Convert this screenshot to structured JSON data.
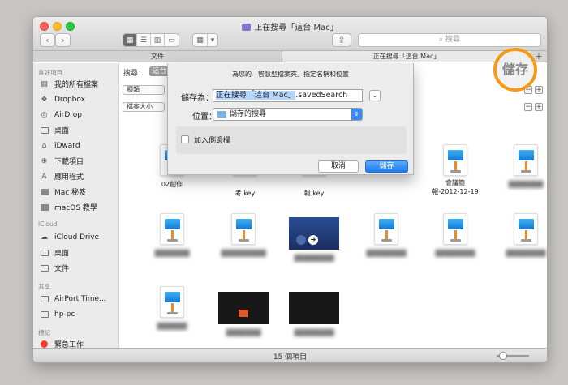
{
  "window": {
    "title": "正在搜尋「這台 Mac」",
    "search_placeholder": "搜尋",
    "nav_back": "‹",
    "nav_forward": "›"
  },
  "tabs": [
    {
      "label": "文件",
      "active": false
    },
    {
      "label": "正在搜尋「這台 Mac」",
      "active": true
    }
  ],
  "tab_add": "+",
  "sidebar": {
    "sections": [
      {
        "heading": "喜好項目",
        "items": [
          {
            "label": "我的所有檔案",
            "icon": "all-files-icon"
          },
          {
            "label": "Dropbox",
            "icon": "dropbox-icon"
          },
          {
            "label": "AirDrop",
            "icon": "airdrop-icon"
          },
          {
            "label": "桌面",
            "icon": "desktop-folder-icon"
          },
          {
            "label": "iDward",
            "icon": "home-icon"
          },
          {
            "label": "下載項目",
            "icon": "downloads-icon"
          },
          {
            "label": "應用程式",
            "icon": "applications-icon"
          },
          {
            "label": "Mac 秘笈",
            "icon": "folder-icon"
          },
          {
            "label": "macOS 教學",
            "icon": "folder-icon"
          }
        ]
      },
      {
        "heading": "iCloud",
        "items": [
          {
            "label": "iCloud Drive",
            "icon": "cloud-icon"
          },
          {
            "label": "桌面",
            "icon": "desktop-folder-icon"
          },
          {
            "label": "文件",
            "icon": "documents-icon"
          }
        ]
      },
      {
        "heading": "共享",
        "items": [
          {
            "label": "AirPort Time...",
            "icon": "airport-icon"
          },
          {
            "label": "hp-pc",
            "icon": "computer-icon"
          }
        ]
      },
      {
        "heading": "標記",
        "items": [
          {
            "label": "緊急工作",
            "icon": "red-tag-icon"
          }
        ]
      }
    ]
  },
  "criteria": {
    "search_label": "搜尋：",
    "scope": "這台",
    "row1_value": "種類",
    "row2_value": "檔案大小",
    "minus": "−",
    "plus": "+"
  },
  "files": [
    {
      "name": "02創作",
      "blurred": false,
      "kind": "keynote"
    },
    {
      "name": "考.key",
      "blurred": false,
      "kind": "keynote"
    },
    {
      "name": "報.key",
      "blurred": false,
      "kind": "keynote"
    },
    {
      "name": "會議簡\n報-2012-12-19",
      "blurred": false,
      "kind": "keynote"
    },
    {
      "name": "▓▓▓▓▓▓▓",
      "blurred": true,
      "kind": "keynote"
    },
    {
      "name": "▓▓▓▓▓▓▓",
      "blurred": true,
      "kind": "keynote"
    },
    {
      "name": "▓▓▓▓▓▓▓▓▓",
      "blurred": true,
      "kind": "keynote"
    },
    {
      "name": "▓▓▓▓▓▓▓▓",
      "blurred": true,
      "kind": "blue-thumb"
    },
    {
      "name": "▓▓▓▓▓▓▓▓",
      "blurred": true,
      "kind": "keynote"
    },
    {
      "name": "▓▓▓▓▓▓▓▓",
      "blurred": true,
      "kind": "keynote"
    },
    {
      "name": "▓▓▓▓▓▓▓▓",
      "blurred": true,
      "kind": "keynote"
    },
    {
      "name": "▓▓▓▓▓▓",
      "blurred": true,
      "kind": "keynote"
    },
    {
      "name": "▓▓▓▓▓▓▓",
      "blurred": true,
      "kind": "dark-thumb"
    },
    {
      "name": "▓▓▓▓▓▓▓▓",
      "blurred": true,
      "kind": "dark-thumb"
    }
  ],
  "status": {
    "item_count": "15 個項目"
  },
  "dialog": {
    "message": "為您的「智慧型檔案夾」指定名稱和位置",
    "save_as_label": "儲存為：",
    "name_selected": "正在搜尋「這台 Mac」",
    "name_suffix": ".savedSearch",
    "where_label": "位置：",
    "location": "儲存的搜尋",
    "add_to_sidebar": "加入側邊欄",
    "cancel": "取消",
    "save": "儲存"
  },
  "annotation": {
    "label": "儲存"
  }
}
